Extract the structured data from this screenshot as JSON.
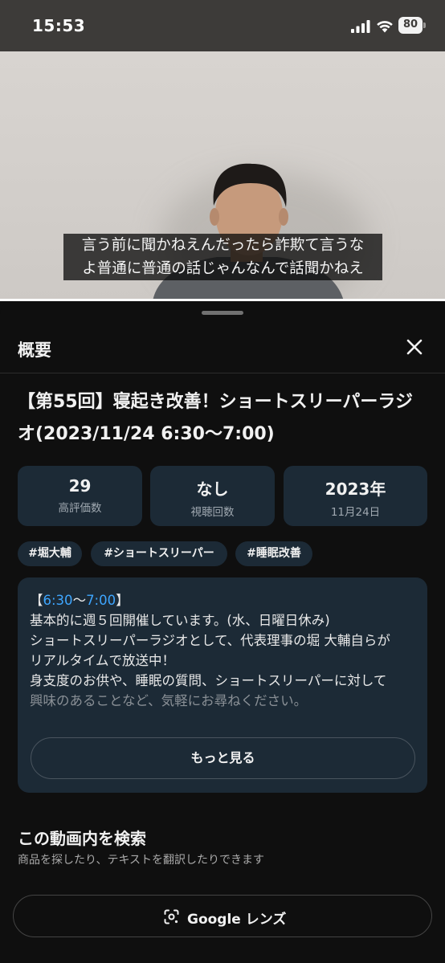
{
  "status_bar": {
    "time": "15:53",
    "battery": "80"
  },
  "video": {
    "caption_lines": [
      "言う前に聞かねえんだったら詐欺て言うな",
      "よ普通に普通の話じゃんなんで話聞かねえ"
    ]
  },
  "sheet": {
    "title": "概要",
    "video_title": "【第55回】寝起き改善！ショートスリーパーラジオ(2023/11/24 6:30〜7:00)",
    "stats": [
      {
        "value": "29",
        "label": "高評価数"
      },
      {
        "value": "なし",
        "label": "視聴回数"
      },
      {
        "value": "2023年",
        "label": "11月24日"
      }
    ],
    "tags": [
      "#堀大輔",
      "#ショートスリーパー",
      "#睡眠改善"
    ],
    "description": {
      "prefix": "【",
      "link_start": "6:30",
      "separator": "〜",
      "link_end": "7:00",
      "suffix": "】",
      "lines": [
        "基本的に週５回開催しています。(水、日曜日休み)",
        "ショートスリーパーラジオとして、代表理事の堀 大輔自らが",
        "リアルタイムで放送中！",
        "身支度のお供や、睡眠の質問、ショートスリーパーに対して",
        "興味のあることなど、気軽にお尋ねください。"
      ],
      "more_label": "もっと見る"
    },
    "search": {
      "title": "この動画内を検索",
      "subtitle": "商品を探したり、テキストを翻訳したりできます",
      "lens_label": "Google レンズ"
    }
  },
  "colors": {
    "accent_link": "#3ea6ff",
    "card_bg": "#1c2a36",
    "sheet_bg": "#0f0f0f"
  }
}
